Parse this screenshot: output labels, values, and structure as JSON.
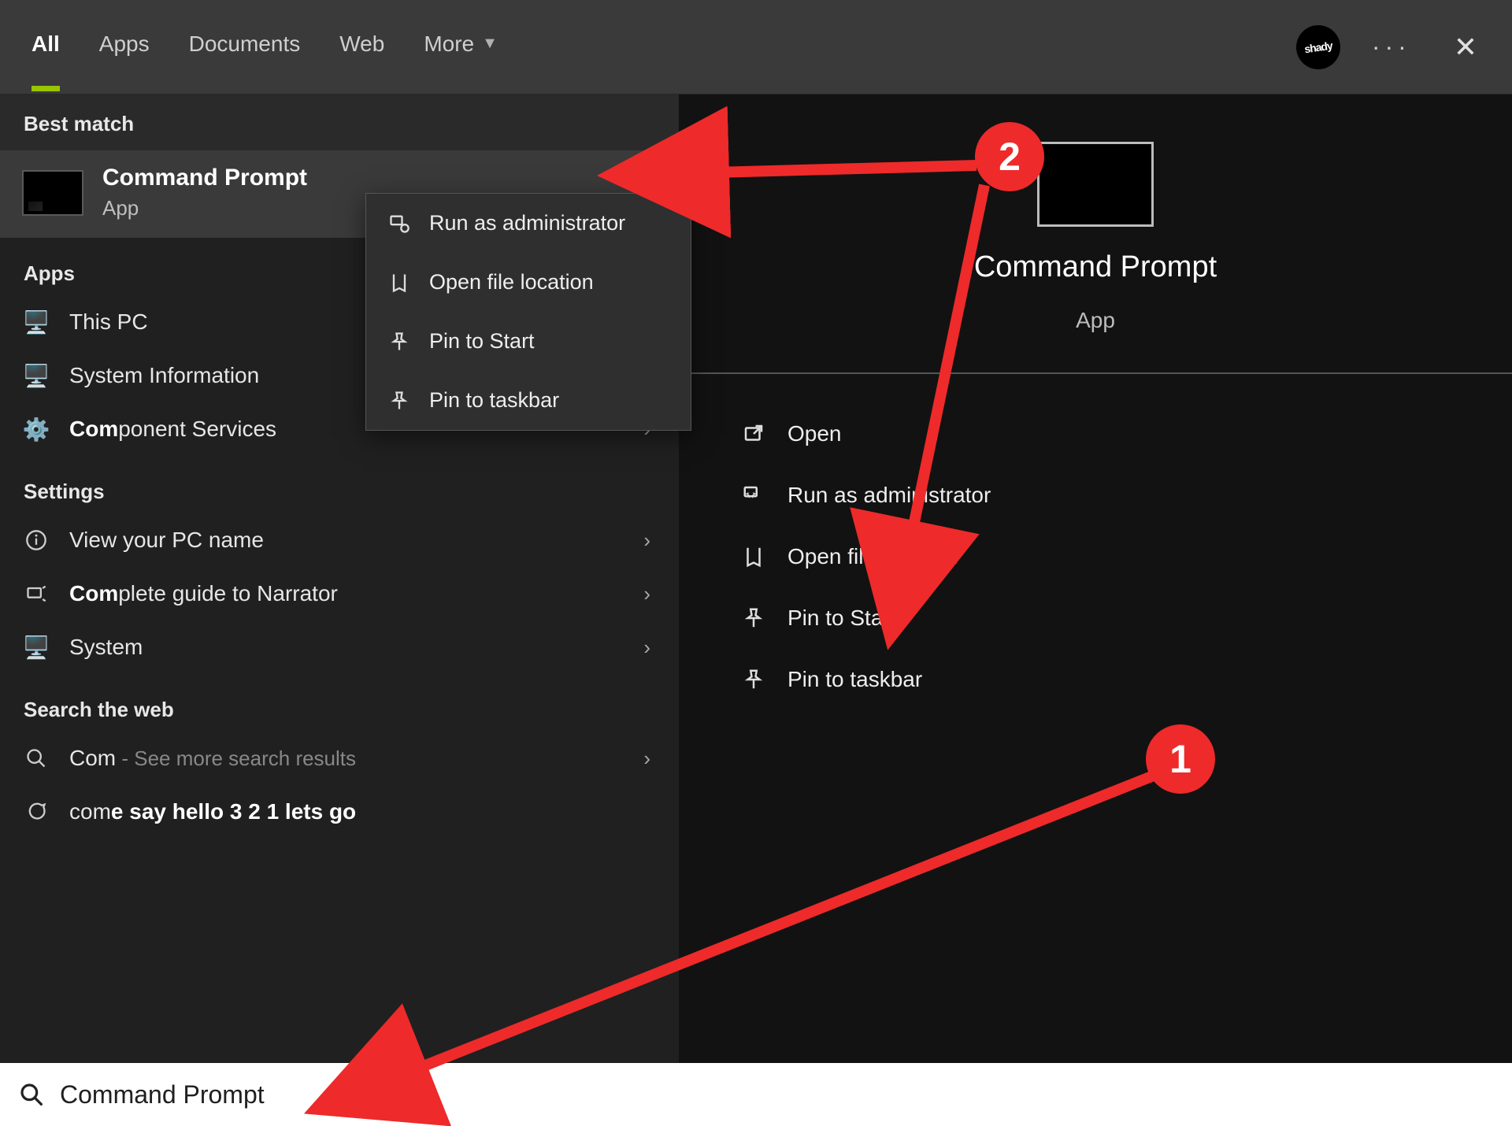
{
  "topbar": {
    "tabs": {
      "all": "All",
      "apps": "Apps",
      "documents": "Documents",
      "web": "Web",
      "more": "More"
    },
    "avatar_text": "shady",
    "ellipsis": "···",
    "close": "✕"
  },
  "left": {
    "best_match_header": "Best match",
    "best_match": {
      "title": "Command Prompt",
      "subtitle": "App"
    },
    "apps_header": "Apps",
    "apps": [
      {
        "label": "This PC"
      },
      {
        "label": "System Information"
      },
      {
        "label_prefix": "Com",
        "label_rest": "ponent Services"
      }
    ],
    "settings_header": "Settings",
    "settings": [
      {
        "label": "View your PC name"
      },
      {
        "label_prefix": "Com",
        "label_rest": "plete guide to Narrator"
      },
      {
        "label": "System"
      }
    ],
    "web_header": "Search the web",
    "web": [
      {
        "label_prefix": "Com",
        "label_dim": " - See more search results"
      },
      {
        "label_prefix": "com",
        "label_bold": "e say hello 3 2 1 lets go"
      }
    ]
  },
  "context_menu": {
    "items": {
      "run_admin": "Run as administrator",
      "open_loc": "Open file location",
      "pin_start": "Pin to Start",
      "pin_taskbar": "Pin to taskbar"
    }
  },
  "right": {
    "title": "Command Prompt",
    "subtitle": "App",
    "actions": {
      "open": "Open",
      "run_admin": "Run as administrator",
      "open_loc": "Open file location",
      "pin_start": "Pin to Start",
      "pin_taskbar": "Pin to taskbar"
    }
  },
  "search": {
    "value": "Command Prompt"
  },
  "annotations": {
    "badge1": "1",
    "badge2": "2"
  }
}
